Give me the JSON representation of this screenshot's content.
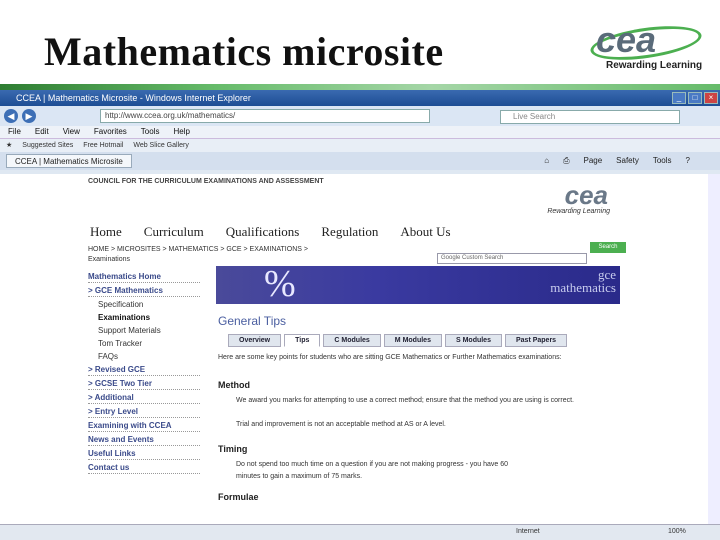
{
  "slide_title": "Mathematics microsite",
  "logo": {
    "mark": "cea",
    "tagline": "Rewarding Learning"
  },
  "browser": {
    "title": "CCEA | Mathematics Microsite - Windows Internet Explorer",
    "url": "http://www.ccea.org.uk/mathematics/",
    "search_placeholder": "Live Search",
    "menu": [
      "File",
      "Edit",
      "View",
      "Favorites",
      "Tools",
      "Help"
    ],
    "favorites": [
      "Suggested Sites",
      "Free Hotmail",
      "Web Slice Gallery"
    ],
    "tab": "CCEA | Mathematics Microsite",
    "tools": [
      "Page",
      "Safety",
      "Tools"
    ],
    "status_zone": "Internet",
    "zoom": "100%"
  },
  "site": {
    "council": "COUNCIL FOR THE CURRICULUM EXAMINATIONS AND ASSESSMENT",
    "logo_mark": "cea",
    "logo_tag": "Rewarding Learning",
    "nav": [
      "Home",
      "Curriculum",
      "Qualifications",
      "Regulation",
      "About Us"
    ],
    "breadcrumb": "HOME > MICROSITES > MATHEMATICS > GCE > EXAMINATIONS >",
    "breadcrumb2": "Examinations",
    "search_box": "Google Custom Search",
    "search_btn": "Search",
    "sidebar": [
      "Mathematics Home",
      "> GCE Mathematics",
      "Specification",
      "Examinations",
      "Support Materials",
      "Tom Tracker",
      "FAQs",
      "> Revised GCE",
      "> GCSE Two Tier",
      "> Additional",
      "> Entry Level",
      "Examining with CCEA",
      "News and Events",
      "Useful Links",
      "Contact us"
    ],
    "banner_symbol": "%",
    "banner_text1": "gce",
    "banner_text2": "mathematics",
    "heading": "General Tips",
    "tabs": [
      "Overview",
      "Tips",
      "C Modules",
      "M Modules",
      "S Modules",
      "Past Papers"
    ],
    "intro": "Here are some key points for students who are sitting GCE Mathematics or Further Mathematics examinations:",
    "method_h": "Method",
    "method_1": "We award you marks for attempting to use a correct method; ensure that the method you are using is correct.",
    "method_2": "Trial and improvement is not an acceptable method at AS or A level.",
    "timing_h": "Timing",
    "timing_1": "Do not spend too much time on a question if you are not making progress - you have 60",
    "timing_2": "minutes to gain a maximum of 75 marks.",
    "formulae_h": "Formulae"
  }
}
